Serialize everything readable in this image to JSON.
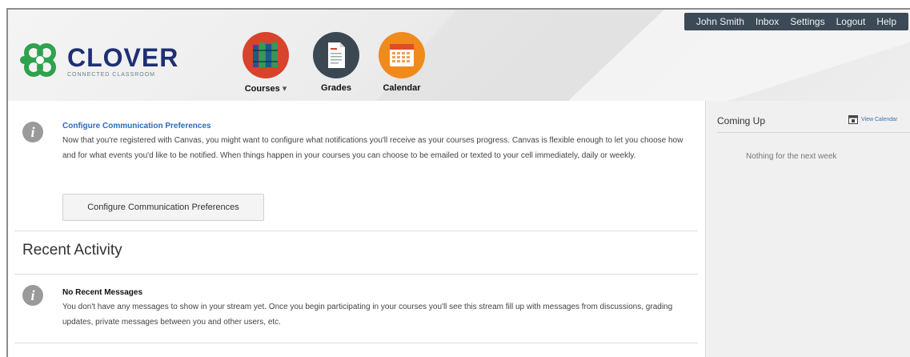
{
  "topnav": {
    "items": [
      "John Smith",
      "Inbox",
      "Settings",
      "Logout",
      "Help"
    ]
  },
  "logo": {
    "name": "CLOVER",
    "subtitle": "CONNECTED CLASSROOM"
  },
  "mainnav": {
    "courses": {
      "label": "Courses",
      "caret": "▾",
      "icon": "books-icon",
      "color": "#d8432b"
    },
    "grades": {
      "label": "Grades",
      "icon": "document-icon",
      "color": "#3b4852"
    },
    "calendar": {
      "label": "Calendar",
      "icon": "calendar-icon",
      "color": "#f08a1c"
    }
  },
  "notice": {
    "title": "Configure Communication Preferences",
    "body": "Now that you're registered with Canvas, you might want to configure what notifications you'll receive as your courses progress. Canvas is flexible enough to let you choose how and for what events you'd like to be notified. When things happen in your courses you can choose to be emailed or texted to your cell immediately, daily or weekly.",
    "button_label": "Configure Communication Preferences"
  },
  "recent": {
    "heading": "Recent Activity",
    "empty_title": "No Recent Messages",
    "empty_body": "You don't have any messages to show in your stream yet. Once you begin participating in your courses you'll see this stream fill up with messages from discussions, grading updates, private messages between you and other users, etc."
  },
  "sidebar": {
    "title": "Coming Up",
    "link_label": "View Calendar",
    "empty_text": "Nothing for the next week"
  },
  "colors": {
    "topnav_bg": "#3c4a57",
    "brand_blue": "#1e2f73",
    "logo_green": "#2fa24d",
    "link_blue": "#2a6bc2"
  }
}
